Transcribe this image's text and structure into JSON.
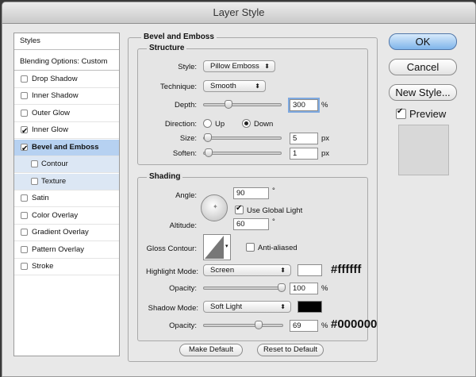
{
  "window": {
    "title": "Layer Style"
  },
  "sidebar": {
    "header": "Styles",
    "blending": "Blending Options: Custom",
    "items": [
      {
        "label": "Drop Shadow",
        "checked": false
      },
      {
        "label": "Inner Shadow",
        "checked": false
      },
      {
        "label": "Outer Glow",
        "checked": false
      },
      {
        "label": "Inner Glow",
        "checked": true
      },
      {
        "label": "Bevel and Emboss",
        "checked": true,
        "selected": true
      },
      {
        "label": "Contour",
        "checked": false,
        "sub": true
      },
      {
        "label": "Texture",
        "checked": false,
        "sub": true
      },
      {
        "label": "Satin",
        "checked": false
      },
      {
        "label": "Color Overlay",
        "checked": false
      },
      {
        "label": "Gradient Overlay",
        "checked": false
      },
      {
        "label": "Pattern Overlay",
        "checked": false
      },
      {
        "label": "Stroke",
        "checked": false
      }
    ]
  },
  "panel": {
    "title": "Bevel and Emboss",
    "structure": {
      "title": "Structure",
      "style_label": "Style:",
      "style_value": "Pillow Emboss",
      "technique_label": "Technique:",
      "technique_value": "Smooth",
      "depth_label": "Depth:",
      "depth_value": "300",
      "depth_unit": "%",
      "direction_label": "Direction:",
      "up_label": "Up",
      "down_label": "Down",
      "direction_selected": "Down",
      "size_label": "Size:",
      "size_value": "5",
      "size_unit": "px",
      "soften_label": "Soften:",
      "soften_value": "1",
      "soften_unit": "px"
    },
    "shading": {
      "title": "Shading",
      "angle_label": "Angle:",
      "angle_value": "90",
      "angle_unit": "°",
      "global_light_label": "Use Global Light",
      "global_light_checked": true,
      "altitude_label": "Altitude:",
      "altitude_value": "60",
      "altitude_unit": "°",
      "gloss_label": "Gloss Contour:",
      "anti_aliased_label": "Anti-aliased",
      "anti_aliased_checked": false,
      "highlight_label": "Highlight Mode:",
      "highlight_value": "Screen",
      "highlight_color": "#ffffff",
      "highlight_note": "#ffffff",
      "highlight_opacity_label": "Opacity:",
      "highlight_opacity_value": "100",
      "highlight_opacity_unit": "%",
      "shadow_label": "Shadow Mode:",
      "shadow_value": "Soft Light",
      "shadow_color": "#000000",
      "shadow_note": "#000000",
      "shadow_opacity_label": "Opacity:",
      "shadow_opacity_value": "69",
      "shadow_opacity_unit": "%"
    },
    "make_default": "Make Default",
    "reset_default": "Reset to Default"
  },
  "buttons": {
    "ok": "OK",
    "cancel": "Cancel",
    "new_style": "New Style...",
    "preview_label": "Preview",
    "preview_checked": true
  }
}
